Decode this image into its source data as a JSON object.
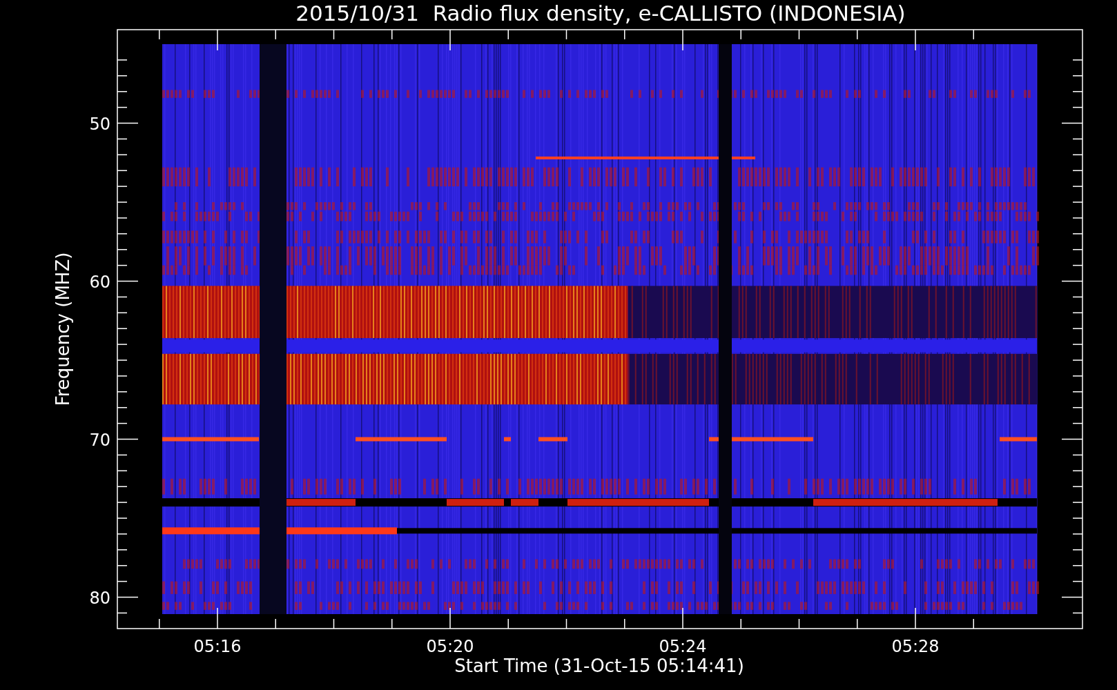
{
  "title": "2015/10/31  Radio flux density, e-CALLISTO (INDONESIA)",
  "y_axis": {
    "label": "Frequency (MHZ)",
    "ticks": [
      "50",
      "60",
      "70",
      "80"
    ]
  },
  "x_axis": {
    "label": "Start Time (31-Oct-15 05:14:41)",
    "ticks": [
      "05:16",
      "05:20",
      "05:24",
      "05:28"
    ]
  }
}
